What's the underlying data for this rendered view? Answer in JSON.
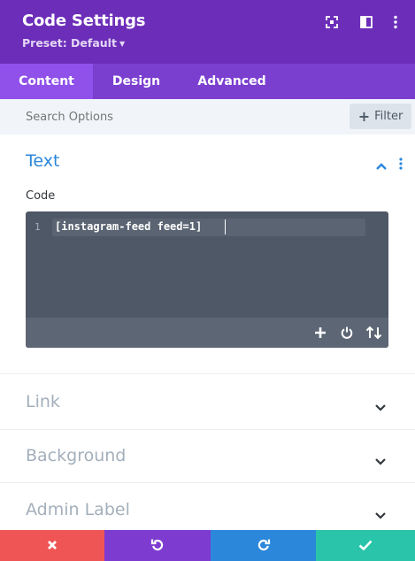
{
  "header": {
    "title": "Code Settings",
    "preset": "Preset: Default",
    "icons": [
      "fullscreen-icon",
      "split-view-icon",
      "more-icon"
    ]
  },
  "tabs": [
    {
      "label": "Content",
      "active": true
    },
    {
      "label": "Design",
      "active": false
    },
    {
      "label": "Advanced",
      "active": false
    }
  ],
  "search": {
    "placeholder": "Search Options",
    "filter_label": "Filter"
  },
  "text_section": {
    "title": "Text",
    "field_label": "Code",
    "line_number": "1",
    "code": "[instagram-feed feed=1]"
  },
  "collapsed_sections": [
    {
      "title": "Link"
    },
    {
      "title": "Background"
    },
    {
      "title": "Admin Label"
    }
  ],
  "footer": {
    "buttons": [
      "cancel-icon",
      "undo-icon",
      "redo-icon",
      "save-icon"
    ]
  },
  "colors": {
    "header": "#6c2eb9",
    "tabs": "#7b3fd0",
    "active_tab": "#8f51ea",
    "accent_blue": "#2b87da",
    "cancel": "#ef5555",
    "undo": "#7e3bd0",
    "redo": "#2b87da",
    "save": "#29c4a9"
  }
}
